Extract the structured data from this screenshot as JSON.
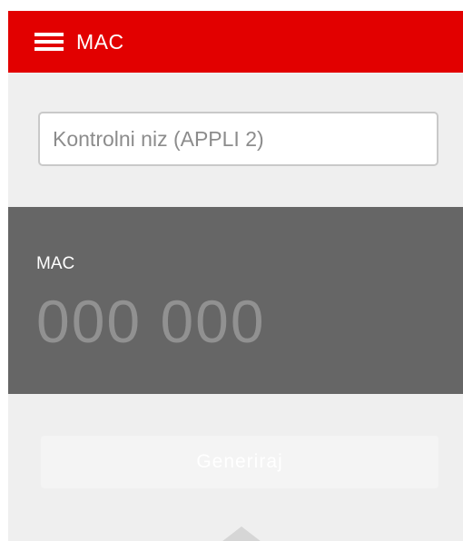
{
  "header": {
    "title": "MAC",
    "menu_icon": "hamburger-menu-icon",
    "color": "#e20000"
  },
  "challenge_input": {
    "placeholder": "Kontrolni niz (APPLI 2)",
    "value": ""
  },
  "mac_panel": {
    "label": "MAC",
    "code": "000 000",
    "background": "#666666"
  },
  "actions": {
    "generate_label": "Generiraj"
  },
  "footer": {
    "arrow_icon": "chevron-up-icon"
  }
}
